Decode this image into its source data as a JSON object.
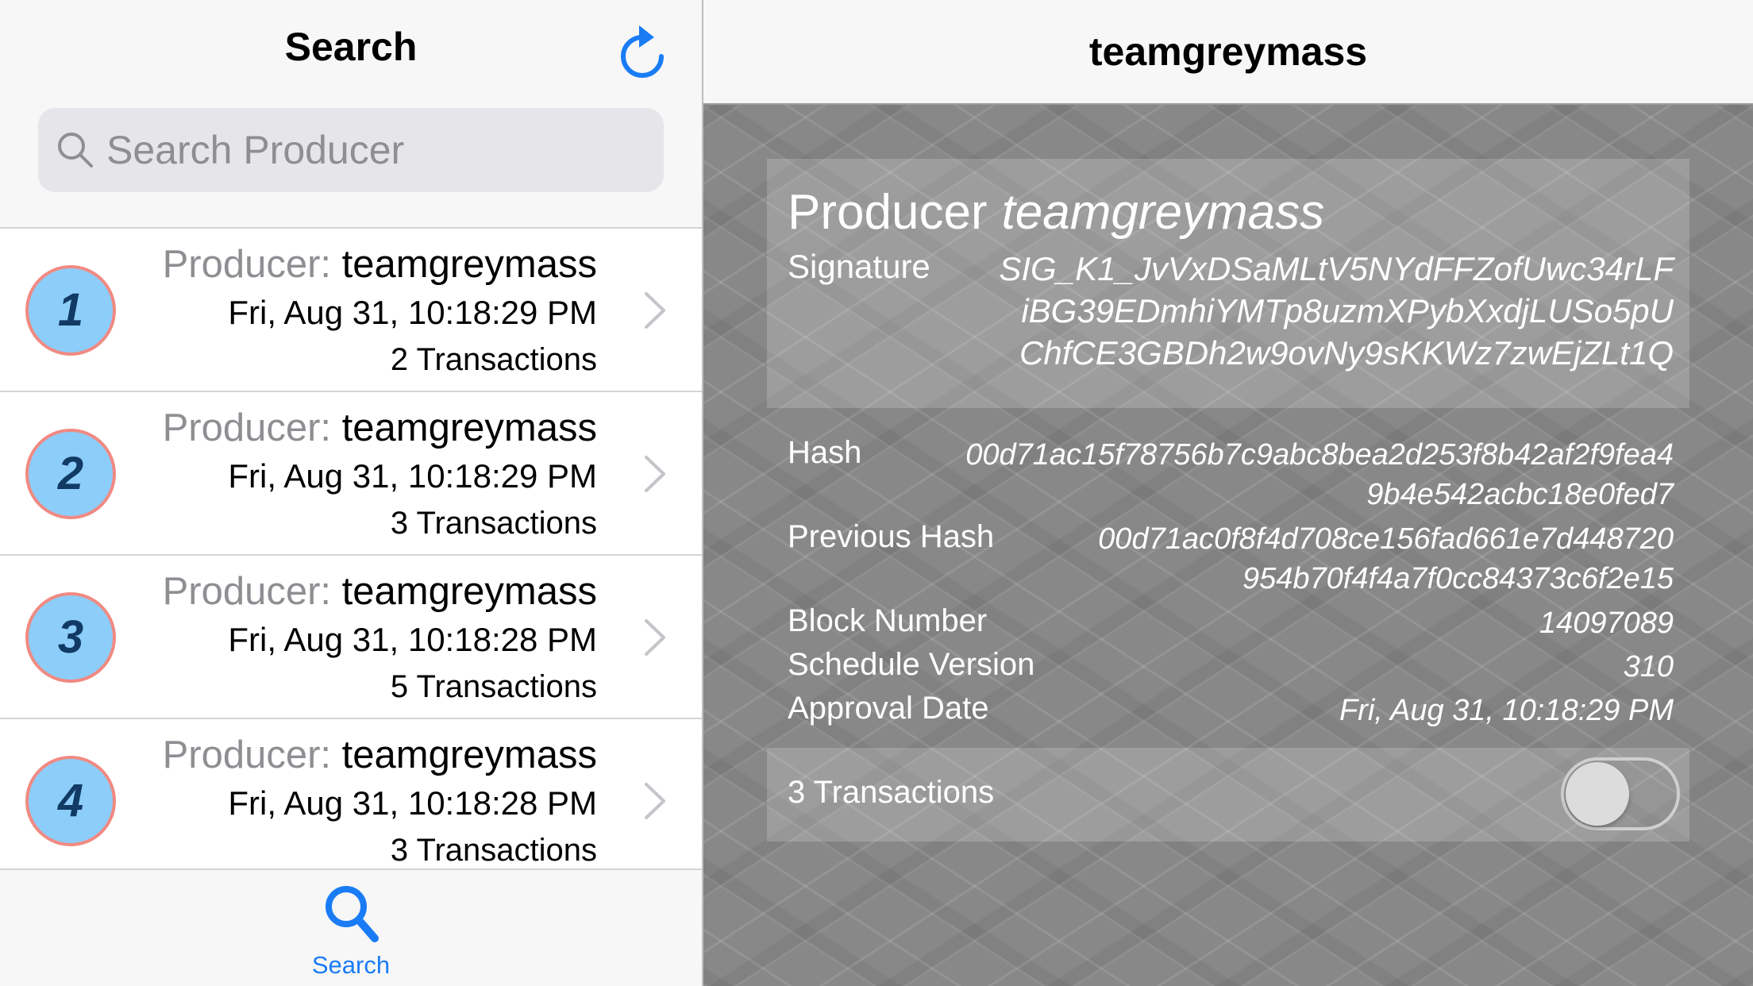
{
  "search_pane": {
    "title": "Search",
    "refresh_icon": "refresh-icon",
    "search_placeholder": "Search Producer",
    "rows": [
      {
        "index": "1",
        "producer_label": "Producer:",
        "producer": "teamgreymass",
        "date": "Fri, Aug 31, 10:18:29 PM",
        "transactions": "2 Transactions"
      },
      {
        "index": "2",
        "producer_label": "Producer:",
        "producer": "teamgreymass",
        "date": "Fri, Aug 31, 10:18:29 PM",
        "transactions": "3 Transactions"
      },
      {
        "index": "3",
        "producer_label": "Producer:",
        "producer": "teamgreymass",
        "date": "Fri, Aug 31, 10:18:28 PM",
        "transactions": "5 Transactions"
      },
      {
        "index": "4",
        "producer_label": "Producer:",
        "producer": "teamgreymass",
        "date": "Fri, Aug 31, 10:18:28 PM",
        "transactions": "3 Transactions"
      }
    ],
    "tab_bar": {
      "search_label": "Search"
    }
  },
  "detail_pane": {
    "title": "teamgreymass",
    "producer_heading": "Producer",
    "producer_name": "teamgreymass",
    "signature_label": "Signature",
    "signature_lines": [
      "SIG_K1_JvVxDSaMLtV5NYdFFZofUwc34rLF",
      "iBG39EDmhiYMTp8uzmXPybXxdjLUSo5pU",
      "ChfCE3GBDh2w9ovNy9sKKWz7zwEjZLt1Q"
    ],
    "hash_label": "Hash",
    "hash_lines": [
      "00d71ac15f78756b7c9abc8bea2d253f8b42af2f9fea4",
      "9b4e542acbc18e0fed7"
    ],
    "previous_hash_label": "Previous Hash",
    "previous_hash_lines": [
      "00d71ac0f8f4d708ce156fad661e7d448720",
      "954b70f4f4a7f0cc84373c6f2e15"
    ],
    "block_number_label": "Block Number",
    "block_number": "14097089",
    "schedule_version_label": "Schedule Version",
    "schedule_version": "310",
    "approval_date_label": "Approval Date",
    "approval_date": "Fri, Aug 31, 10:18:29 PM",
    "transactions_label": "3 Transactions",
    "transactions_toggle_on": false
  },
  "colors": {
    "accent_blue": "#1a7cf5",
    "badge_fill": "#8dcdfa",
    "badge_border": "#f08a82",
    "detail_background": "#888888"
  }
}
